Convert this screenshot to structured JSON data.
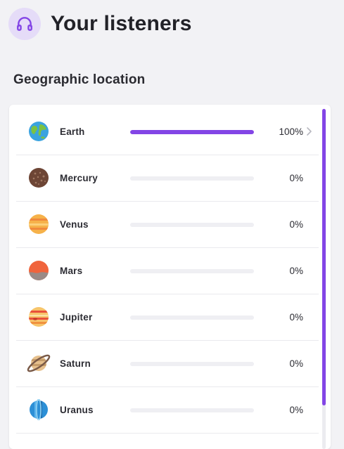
{
  "header": {
    "title": "Your listeners",
    "icon": "headphones-icon"
  },
  "section": {
    "title": "Geographic location"
  },
  "locations": [
    {
      "name": "Earth",
      "percent_label": "100%",
      "fraction": 1.0,
      "icon": "earth-icon",
      "has_chevron": true
    },
    {
      "name": "Mercury",
      "percent_label": "0%",
      "fraction": 0,
      "icon": "mercury-icon"
    },
    {
      "name": "Venus",
      "percent_label": "0%",
      "fraction": 0,
      "icon": "venus-icon"
    },
    {
      "name": "Mars",
      "percent_label": "0%",
      "fraction": 0,
      "icon": "mars-icon"
    },
    {
      "name": "Jupiter",
      "percent_label": "0%",
      "fraction": 0,
      "icon": "jupiter-icon"
    },
    {
      "name": "Saturn",
      "percent_label": "0%",
      "fraction": 0,
      "icon": "saturn-icon"
    },
    {
      "name": "Uranus",
      "percent_label": "0%",
      "fraction": 0,
      "icon": "uranus-icon"
    }
  ],
  "colors": {
    "accent": "#8345e6",
    "icon_bg": "#e5dcf8",
    "track": "#efeff3"
  }
}
